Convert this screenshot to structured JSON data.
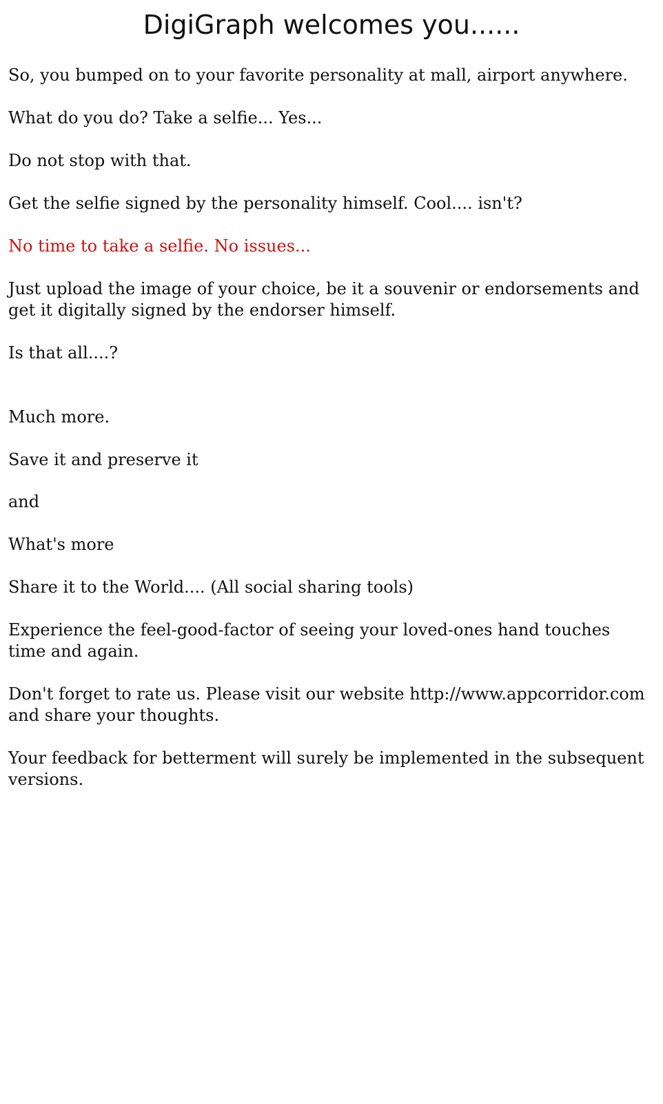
{
  "page": {
    "title": "DigiGraph welcomes you......"
  },
  "paragraphs": [
    "So, you bumped on to your favorite personality at mall, airport anywhere.",
    "What do you do? Take a selfie...  Yes...",
    "Do not stop with that.",
    "Get the selfie signed by the personality himself.  Cool.... isn't?",
    "No time to take a selfie. No issues...",
    "Just upload the image of your choice, be it a souvenir or endorsements and get it digitally signed by the endorser himself.",
    "Is that all....?",
    "Much more.",
    "Save it and preserve it",
    "and",
    "What's more",
    "Share it to the World.... (All social sharing tools)",
    "Experience the feel-good-factor of seeing your loved-ones hand touches time and again.",
    "Don't forget to rate us. Please visit our website http://www.appcorridor.com and share your thoughts.",
    "Your feedback for betterment will surely be implemented in the subsequent versions."
  ],
  "colors": {
    "text": "#111111",
    "highlight": "#cc1111",
    "background": "#ffffff"
  }
}
